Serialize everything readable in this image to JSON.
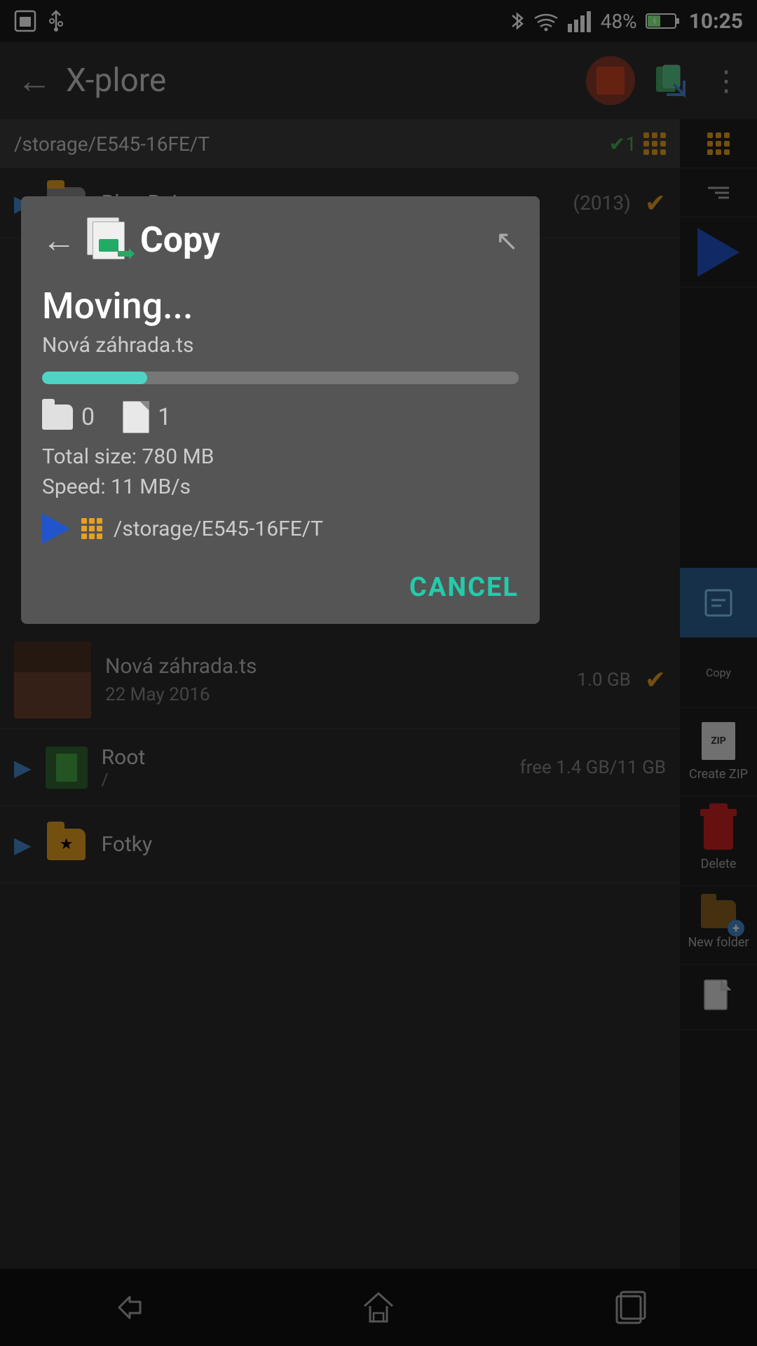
{
  "statusBar": {
    "time": "10:25",
    "battery": "48%",
    "icons": [
      "usb",
      "bluetooth",
      "wifi",
      "signal"
    ]
  },
  "appBar": {
    "backLabel": "←",
    "title": "X-plore",
    "moreLabel": "⋮"
  },
  "leftPanel": {
    "pathBar": {
      "path": "/storage/E545-16FE/T",
      "checkBadge": "✔1"
    },
    "items": [
      {
        "name": "Blue Ruin",
        "year": "(2013)"
      }
    ],
    "bottomItems": [
      {
        "type": "file",
        "name": "Nová záhrada.ts",
        "date": "22 May 2016",
        "size": "1.0 GB"
      },
      {
        "type": "root",
        "name": "Root",
        "path": "/",
        "free": "free 1.4 GB/11 GB"
      },
      {
        "type": "starred-folder",
        "name": "Fotky"
      }
    ]
  },
  "rightPanel": {
    "actions": [
      {
        "label": "Create ZIP",
        "icon": "zip"
      },
      {
        "label": "Delete",
        "icon": "trash"
      },
      {
        "label": "New folder",
        "icon": "new-folder"
      },
      {
        "label": "",
        "icon": "blank-file"
      }
    ]
  },
  "dialog": {
    "backLabel": "←",
    "titleIcon": "copy-icon",
    "title": "Copy",
    "collapseIcon": "↖",
    "statusText": "Moving...",
    "filename": "Nová záhrada.ts",
    "progressPercent": 22,
    "stats": {
      "folderCount": 0,
      "fileCount": 1,
      "totalSizeLabel": "Total size:",
      "totalSize": "780 MB",
      "speedLabel": "Speed:",
      "speed": "11 MB/s"
    },
    "destination": {
      "path": "/storage/E545-16FE/T"
    },
    "cancelLabel": "CANCEL"
  },
  "bottomNav": {
    "back": "↩",
    "home": "⌂",
    "recents": "⬜"
  }
}
